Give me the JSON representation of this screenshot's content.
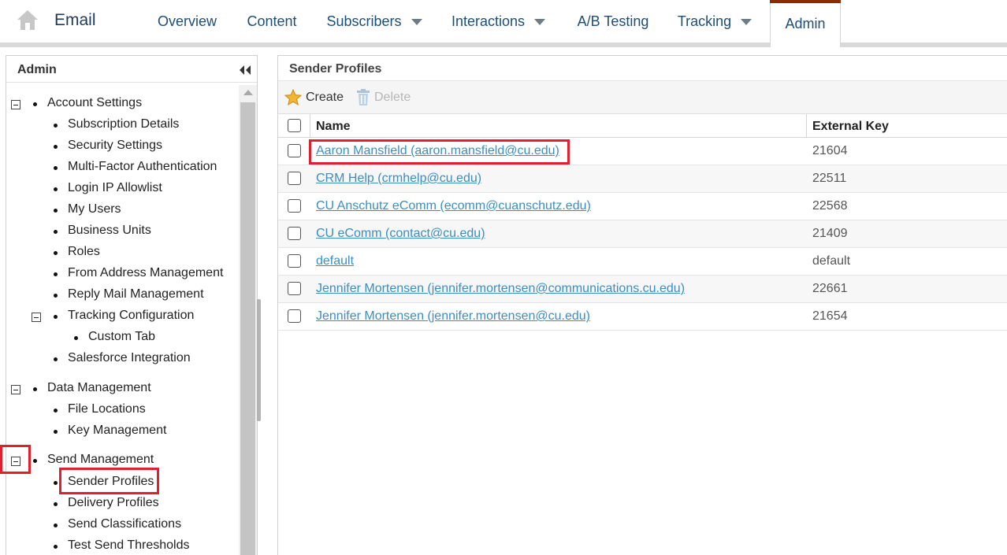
{
  "header": {
    "app_title": "Email",
    "tabs": [
      {
        "label": "Overview"
      },
      {
        "label": "Content"
      },
      {
        "label": "Subscribers"
      },
      {
        "label": "Interactions"
      },
      {
        "label": "A/B Testing"
      },
      {
        "label": "Tracking"
      },
      {
        "label": "Admin"
      }
    ],
    "active_tab": "Admin",
    "accent_color": "#8c2a00"
  },
  "sidebar": {
    "title": "Admin",
    "sections": [
      {
        "label": "Account Settings",
        "items": [
          "Subscription Details",
          "Security Settings",
          "Multi-Factor Authentication",
          "Login IP Allowlist",
          "My Users",
          "Business Units",
          "Roles",
          "From Address Management",
          "Reply Mail Management",
          "Tracking Configuration",
          "Custom Tab",
          "Salesforce Integration"
        ]
      },
      {
        "label": "Data Management",
        "items": [
          "File Locations",
          "Key Management"
        ]
      },
      {
        "label": "Send Management",
        "items": [
          "Sender Profiles",
          "Delivery Profiles",
          "Send Classifications",
          "Test Send Thresholds"
        ]
      }
    ],
    "selected_item": "Sender Profiles"
  },
  "main": {
    "title": "Sender Profiles",
    "toolbar": {
      "create_label": "Create",
      "delete_label": "Delete"
    },
    "columns": {
      "name": "Name",
      "external_key": "External Key"
    },
    "rows": [
      {
        "name": "Aaron Mansfield (aaron.mansfield@cu.edu)",
        "external_key": "21604"
      },
      {
        "name": "CRM Help (crmhelp@cu.edu)",
        "external_key": "22511"
      },
      {
        "name": "CU Anschutz eComm (ecomm@cuanschutz.edu)",
        "external_key": "22568"
      },
      {
        "name": "CU eComm (contact@cu.edu)",
        "external_key": "21409"
      },
      {
        "name": "default",
        "external_key": "default"
      },
      {
        "name": "Jennifer Mortensen (jennifer.mortensen@communications.cu.edu)",
        "external_key": "22661"
      },
      {
        "name": "Jennifer Mortensen (jennifer.mortensen@cu.edu)",
        "external_key": "21654"
      }
    ],
    "link_color": "#3b8ec2"
  },
  "annotations": {
    "highlight_color": "#e0202e"
  }
}
